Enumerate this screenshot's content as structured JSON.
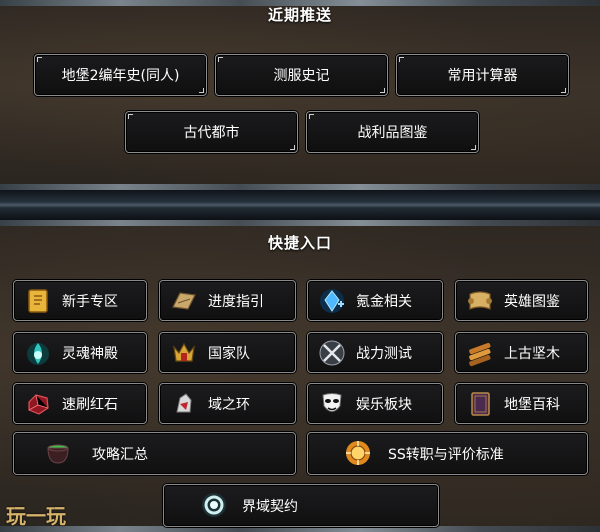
{
  "sections": {
    "recent": "近期推送",
    "quick": "快捷入口"
  },
  "recent_buttons": [
    "地堡2编年史(同人)",
    "测服史记",
    "常用计算器",
    "古代都市",
    "战利品图鉴"
  ],
  "quick_buttons": [
    {
      "label": "新手专区",
      "icon": "scroll-icon"
    },
    {
      "label": "进度指引",
      "icon": "map-icon"
    },
    {
      "label": "氪金相关",
      "icon": "crystal-icon"
    },
    {
      "label": "英雄图鉴",
      "icon": "parchment-icon"
    },
    {
      "label": "灵魂神殿",
      "icon": "soul-flame-icon"
    },
    {
      "label": "国家队",
      "icon": "crown-emblem-icon"
    },
    {
      "label": "战力测试",
      "icon": "crossed-swords-icon"
    },
    {
      "label": "上古坚木",
      "icon": "wood-icon"
    },
    {
      "label": "速刷红石",
      "icon": "red-stone-icon"
    },
    {
      "label": "域之环",
      "icon": "ring-icon"
    },
    {
      "label": "娱乐板块",
      "icon": "mask-icon"
    },
    {
      "label": "地堡百科",
      "icon": "book-icon"
    },
    {
      "label": "攻略汇总",
      "icon": "cauldron-icon"
    },
    {
      "label": "SS转职与评价标准",
      "icon": "sun-emblem-icon"
    },
    {
      "label": "界域契约",
      "icon": "portal-icon"
    }
  ],
  "watermark": "玩一玩"
}
